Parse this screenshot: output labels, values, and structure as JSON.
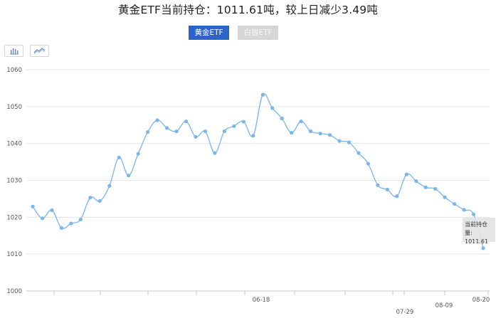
{
  "title": "黄金ETF当前持仓：1011.61吨，较上日减少3.49吨",
  "tabs": [
    {
      "label": "黄金ETF",
      "active": true
    },
    {
      "label": "白银ETF",
      "active": false
    }
  ],
  "chart_controls": [
    {
      "name": "bar-chart-toggle",
      "icon": "bar-chart-icon"
    },
    {
      "name": "line-chart-toggle",
      "icon": "line-chart-icon"
    }
  ],
  "tooltip": {
    "label": "当前持仓量:",
    "value": "1011.61"
  },
  "colors": {
    "line": "#7cb5ec",
    "tab_active": "#2e63c9",
    "tab_inactive": "#d6d6d6",
    "grid": "#e6e6e6"
  },
  "chart_data": {
    "type": "line",
    "title": "黄金ETF当前持仓：1011.61吨，较上日减少3.49吨",
    "xlabel": "",
    "ylabel": "",
    "ylim": [
      1000,
      1060
    ],
    "yticks": [
      1000,
      1010,
      1020,
      1030,
      1040,
      1050,
      1060
    ],
    "xtick_labels": [
      "06-18",
      "07-29",
      "08-09",
      "08-20"
    ],
    "grid": true,
    "legend": "none",
    "series": [
      {
        "values": [
          1022.9,
          1019.7,
          1021.9,
          1017.1,
          1018.3,
          1019.4,
          1025.3,
          1024.4,
          1028.5,
          1036.2,
          1031.3,
          1037.2,
          1043.1,
          1046.3,
          1044.2,
          1043.3,
          1046.0,
          1041.8,
          1043.3,
          1037.4,
          1043.3,
          1044.7,
          1045.9,
          1042.1,
          1053.2,
          1049.6,
          1046.8,
          1042.9,
          1046.0,
          1043.3,
          1042.7,
          1042.3,
          1040.7,
          1040.3,
          1037.4,
          1034.5,
          1028.7,
          1027.5,
          1025.7,
          1031.6,
          1029.8,
          1028.1,
          1027.7,
          1025.4,
          1023.6,
          1022.0,
          1020.8,
          1011.6
        ]
      }
    ]
  }
}
